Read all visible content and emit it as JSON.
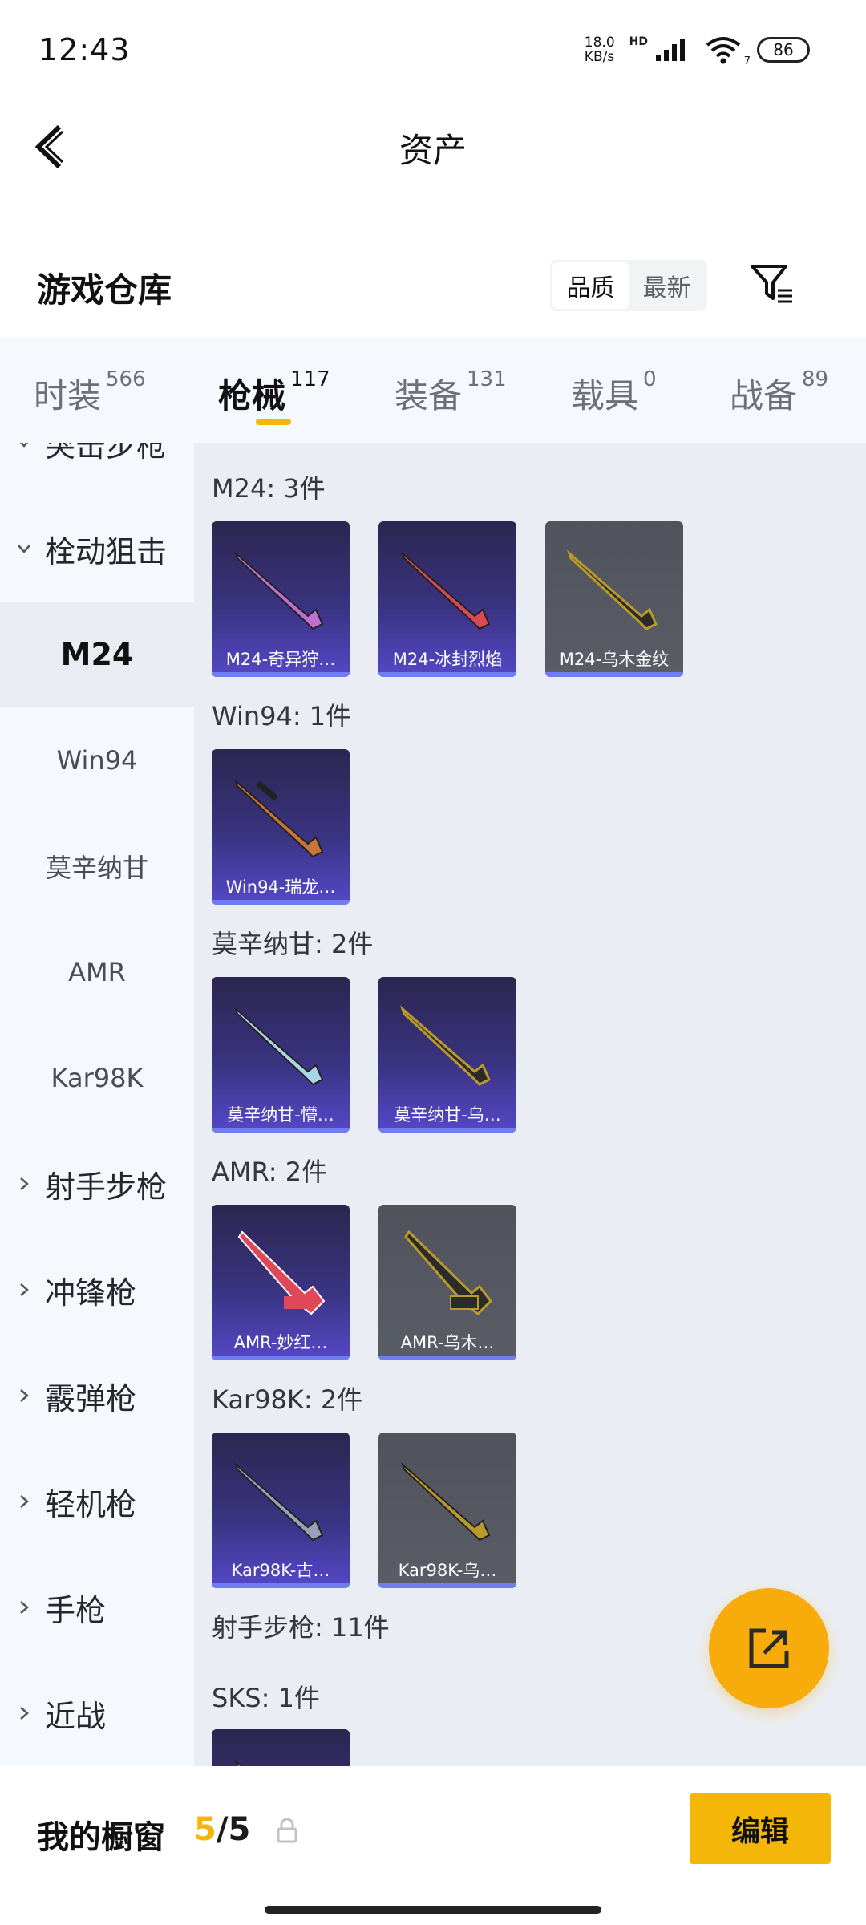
{
  "status_bar": {
    "time": "12:43",
    "net_speed_value": "18.0",
    "net_speed_unit": "KB/s",
    "hd": "HD",
    "wifi_sub": "7",
    "battery": "86"
  },
  "header": {
    "title": "资产",
    "back_icon": "chevron-left-icon"
  },
  "section": {
    "title": "游戏仓库",
    "sort_options": [
      "品质",
      "最新"
    ],
    "selected_sort": "品质",
    "filter_icon": "filter-icon"
  },
  "tabs": [
    {
      "label": "时装",
      "count": "566"
    },
    {
      "label": "枪械",
      "count": "117"
    },
    {
      "label": "装备",
      "count": "131"
    },
    {
      "label": "载具",
      "count": "0"
    },
    {
      "label": "战备",
      "count": "89"
    }
  ],
  "active_tab": "枪械",
  "sidebar": {
    "groups": [
      {
        "label": "突击步枪",
        "expanded": true
      },
      {
        "label": "栓动狙击",
        "expanded": true
      },
      {
        "label": "射手步枪",
        "expanded": false
      },
      {
        "label": "冲锋枪",
        "expanded": false
      },
      {
        "label": "霰弹枪",
        "expanded": false
      },
      {
        "label": "轻机枪",
        "expanded": false
      },
      {
        "label": "手枪",
        "expanded": false
      },
      {
        "label": "近战",
        "expanded": false
      }
    ],
    "subitems": [
      "M24",
      "Win94",
      "莫辛纳甘",
      "AMR",
      "Kar98K"
    ],
    "selected_subitem": "M24"
  },
  "content": {
    "groups": [
      {
        "label": "M24: 3件",
        "items": [
          {
            "name": "M24-奇异狩…",
            "rarity": "purple",
            "color": "#c06fd0"
          },
          {
            "name": "M24-冰封烈焰",
            "rarity": "purple",
            "color": "#d94a55"
          },
          {
            "name": "M24-乌木金纹",
            "rarity": "gray",
            "color": "#b99a2a"
          }
        ]
      },
      {
        "label": "Win94: 1件",
        "items": [
          {
            "name": "Win94-瑞龙…",
            "rarity": "purple",
            "color": "#c9743a"
          }
        ]
      },
      {
        "label": "莫辛纳甘: 2件",
        "items": [
          {
            "name": "莫辛纳甘-懵…",
            "rarity": "purple",
            "color": "#a9d4e6"
          },
          {
            "name": "莫辛纳甘-乌…",
            "rarity": "purple",
            "color": "#b99a2a"
          }
        ]
      },
      {
        "label": "AMR: 2件",
        "items": [
          {
            "name": "AMR-妙红…",
            "rarity": "purple",
            "color": "#e0485a"
          },
          {
            "name": "AMR-乌木…",
            "rarity": "gray",
            "color": "#b99a2a"
          }
        ]
      },
      {
        "label": "Kar98K: 2件",
        "items": [
          {
            "name": "Kar98K-古…",
            "rarity": "purple",
            "color": "#9aa0b8"
          },
          {
            "name": "Kar98K-乌…",
            "rarity": "gray",
            "color": "#b99a2a"
          }
        ]
      }
    ],
    "next_group_label": "射手步枪: 11件",
    "sub_group_label": "SKS: 1件"
  },
  "fab": {
    "icon": "share-external-icon"
  },
  "bottom": {
    "showcase_label": "我的橱窗",
    "showcase_current": "5",
    "showcase_sep": "/",
    "showcase_total": "5",
    "lock_icon": "lock-icon",
    "edit_label": "编辑"
  },
  "colors": {
    "accent": "#f5b60a",
    "fab": "#f7ac0b",
    "purple_card": "#3a3380",
    "gray_card": "#5a5d66"
  }
}
